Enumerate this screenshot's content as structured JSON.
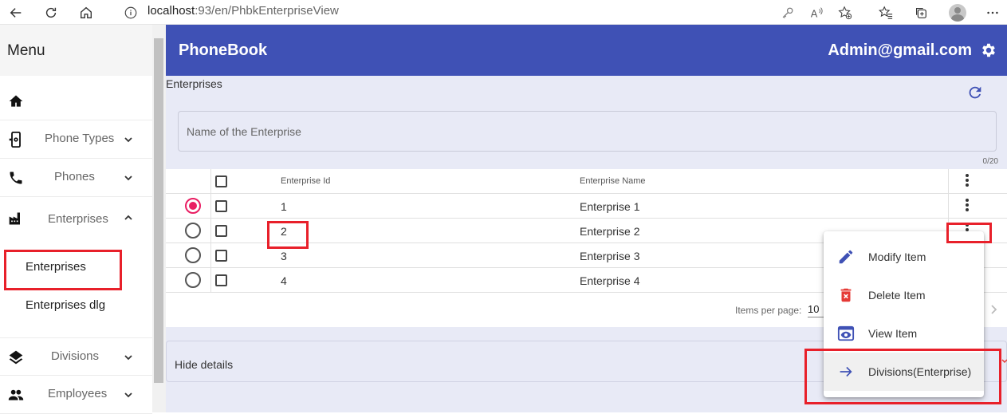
{
  "browser": {
    "url_host": "localhost",
    "url_path": ":93/en/PhbkEnterpriseView"
  },
  "sidebar": {
    "title": "Menu",
    "items": [
      {
        "label": "",
        "icon": "home-icon"
      },
      {
        "label": "Phone Types",
        "icon": "phone-settings-icon"
      },
      {
        "label": "Phones",
        "icon": "phone-icon"
      },
      {
        "label": "Enterprises",
        "icon": "factory-icon"
      },
      {
        "label": "Divisions",
        "icon": "layers-icon"
      },
      {
        "label": "Employees",
        "icon": "people-icon"
      }
    ],
    "sub_items": [
      "Enterprises",
      "Enterprises dlg"
    ]
  },
  "appbar": {
    "title": "PhoneBook",
    "user": "Admin@gmail.com"
  },
  "page": {
    "section_title": "Enterprises",
    "search_placeholder": "Name of the Enterprise",
    "counter": "0/20"
  },
  "table": {
    "columns": [
      "Enterprise Id",
      "Enterprise Name"
    ],
    "rows": [
      {
        "id": "1",
        "name": "Enterprise 1",
        "selected": true
      },
      {
        "id": "2",
        "name": "Enterprise 2",
        "selected": false
      },
      {
        "id": "3",
        "name": "Enterprise 3",
        "selected": false
      },
      {
        "id": "4",
        "name": "Enterprise 4",
        "selected": false
      }
    ]
  },
  "paginator": {
    "items_per_page_label": "Items per page:",
    "items_per_page_value": "10"
  },
  "details": {
    "label": "Hide details"
  },
  "context_menu": {
    "items": [
      {
        "label": "Modify Item",
        "icon": "pencil-icon"
      },
      {
        "label": "Delete Item",
        "icon": "delete-icon"
      },
      {
        "label": "View Item",
        "icon": "eye-icon"
      },
      {
        "label": "Divisions(Enterprise)",
        "icon": "arrow-right-icon"
      }
    ]
  },
  "colors": {
    "primary": "#3f51b5",
    "background": "#e8eaf6",
    "accent": "#e91e63",
    "highlight_box": "#e8202a",
    "delete": "#e53935"
  }
}
